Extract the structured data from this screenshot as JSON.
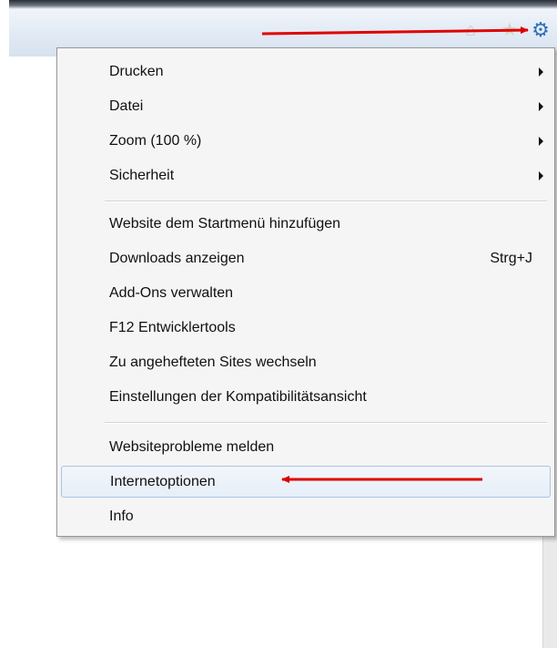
{
  "toolbar": {
    "home_icon": "home-icon",
    "favorites_icon": "star-icon",
    "tools_icon": "gear-icon"
  },
  "menu": {
    "groups": [
      {
        "items": [
          {
            "label": "Drucken",
            "has_submenu": true
          },
          {
            "label": "Datei",
            "has_submenu": true
          },
          {
            "label": "Zoom (100 %)",
            "has_submenu": true
          },
          {
            "label": "Sicherheit",
            "has_submenu": true
          }
        ]
      },
      {
        "items": [
          {
            "label": "Website dem Startmenü hinzufügen"
          },
          {
            "label": "Downloads anzeigen",
            "shortcut": "Strg+J"
          },
          {
            "label": "Add-Ons verwalten"
          },
          {
            "label": "F12 Entwicklertools"
          },
          {
            "label": "Zu angehefteten Sites wechseln"
          },
          {
            "label": "Einstellungen der Kompatibilitätsansicht"
          }
        ]
      },
      {
        "items": [
          {
            "label": "Websiteprobleme melden"
          },
          {
            "label": "Internetoptionen",
            "highlighted": true
          },
          {
            "label": "Info"
          }
        ]
      }
    ]
  },
  "annotations": {
    "arrow_color": "#e00000"
  }
}
